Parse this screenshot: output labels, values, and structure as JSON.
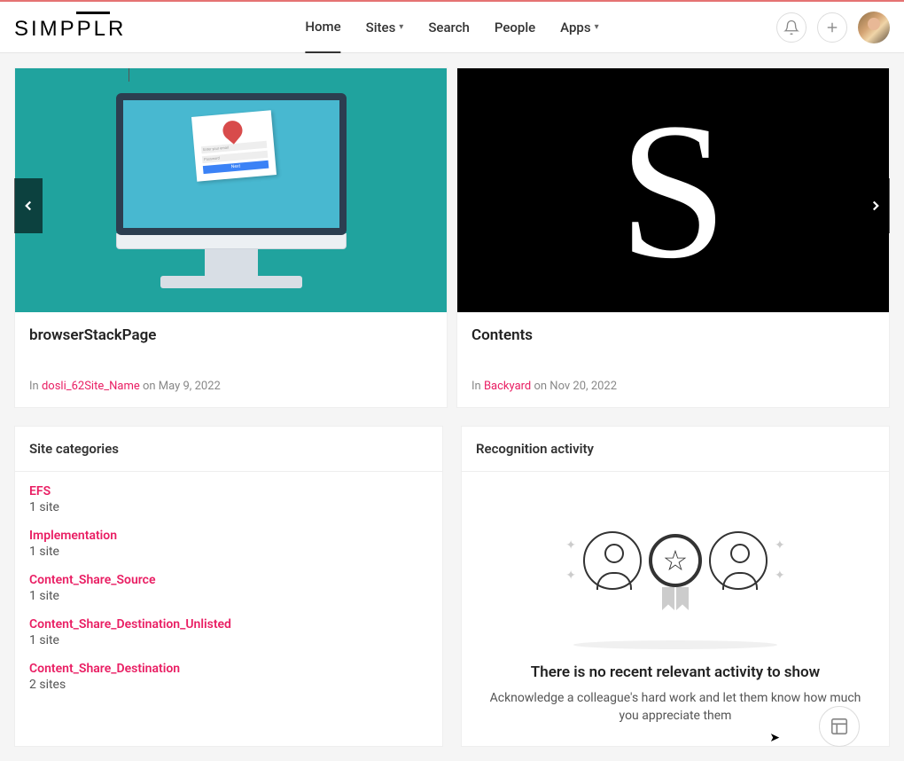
{
  "brand": "SIMPPLR",
  "nav": {
    "home": "Home",
    "sites": "Sites",
    "search": "Search",
    "people": "People",
    "apps": "Apps"
  },
  "carousel": {
    "cards": [
      {
        "title": "browserStackPage",
        "prefix": "In ",
        "site": "dosli_62Site_Name",
        "date": " on May 9, 2022",
        "form_title": "Enter your email",
        "form_pass": "Password",
        "form_btn": "Next"
      },
      {
        "title": "Contents",
        "prefix": "In ",
        "site": "Backyard",
        "date": " on Nov 20, 2022",
        "letter": "S"
      }
    ]
  },
  "categories": {
    "header": "Site categories",
    "items": [
      {
        "name": "EFS",
        "count": "1 site"
      },
      {
        "name": "Implementation",
        "count": "1 site"
      },
      {
        "name": "Content_Share_Source",
        "count": "1 site"
      },
      {
        "name": "Content_Share_Destination_Unlisted",
        "count": "1 site"
      },
      {
        "name": "Content_Share_Destination",
        "count": "2 sites"
      }
    ]
  },
  "recognition": {
    "header": "Recognition activity",
    "title": "There is no recent relevant activity to show",
    "sub": "Acknowledge a colleague's hard work and let them know how much you appreciate them"
  }
}
